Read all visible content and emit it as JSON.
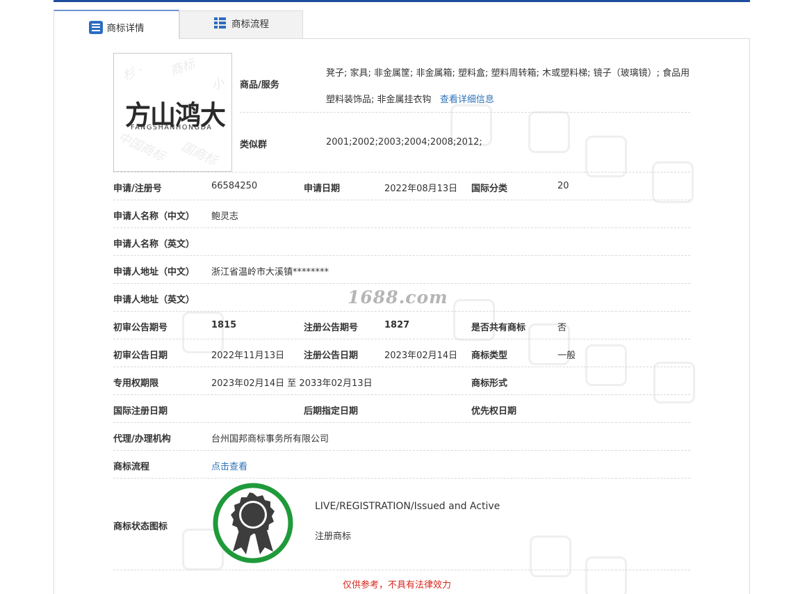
{
  "tabs": {
    "details": "商标详情",
    "process": "商标流程"
  },
  "logo": {
    "cn": "方山鸿大",
    "en": "FANGSHANHONGDA"
  },
  "goods": {
    "label": "商品/服务",
    "text": "凳子; 家具; 非金属筐; 非金属箱; 塑料盒; 塑料周转箱; 木或塑料梯; 镜子（玻璃镜）; 食品用塑料装饰品; 非金属挂衣钩",
    "link": "查看详细信息"
  },
  "similar": {
    "label": "类似群",
    "value": "2001;2002;2003;2004;2008;2012;"
  },
  "rows": {
    "reg_no_label": "申请/注册号",
    "reg_no": "66584250",
    "apply_date_label": "申请日期",
    "apply_date": "2022年08月13日",
    "intl_class_label": "国际分类",
    "intl_class": "20",
    "applicant_cn_label": "申请人名称（中文）",
    "applicant_cn": "鲍灵志",
    "applicant_en_label": "申请人名称（英文）",
    "address_cn_label": "申请人地址（中文）",
    "address_cn": "浙江省温岭市大溪镇********",
    "address_en_label": "申请人地址（英文）",
    "prelim_no_label": "初审公告期号",
    "prelim_no": "1815",
    "reg_ann_no_label": "注册公告期号",
    "reg_ann_no": "1827",
    "shared_label": "是否共有商标",
    "shared": "否",
    "prelim_date_label": "初审公告日期",
    "prelim_date": "2022年11月13日",
    "reg_ann_date_label": "注册公告日期",
    "reg_ann_date": "2023年02月14日",
    "type_label": "商标类型",
    "type": "一般",
    "period_label": "专用权期限",
    "period": "2023年02月14日 至 2033年02月13日",
    "form_label": "商标形式",
    "intl_reg_label": "国际注册日期",
    "later_label": "后期指定日期",
    "priority_label": "优先权日期",
    "agent_label": "代理/办理机构",
    "agent": "台州国邦商标事务所有限公司",
    "process_label": "商标流程",
    "process_link": "点击查看",
    "status_label": "商标状态图标",
    "status_en": "LIVE/REGISTRATION/Issued and Active",
    "status_cn": "注册商标"
  },
  "watermark": "1688.com",
  "footnote": "仅供参考，不具有法律效力",
  "colors": {
    "accent": "#1e4d9e",
    "link": "#2f73b8",
    "badge_ring": "#1f9a3a",
    "footnote": "#d9261c"
  }
}
